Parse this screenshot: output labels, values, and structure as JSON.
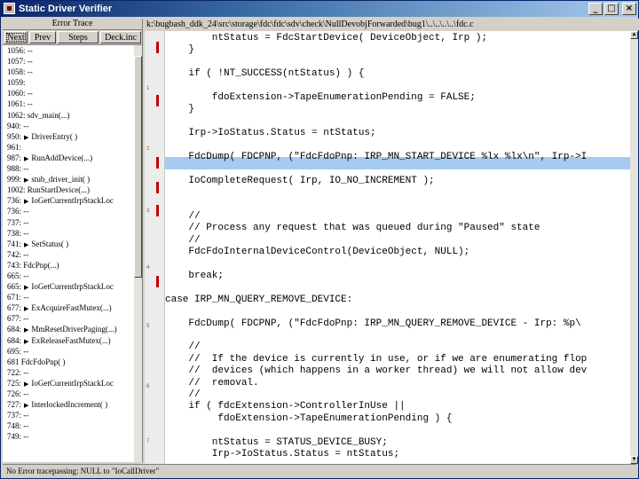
{
  "window": {
    "title": "Static Driver Verifier",
    "controls": {
      "minimize": "_",
      "maximize": "□",
      "close": "×"
    }
  },
  "trace_pane": {
    "title": "Error Trace",
    "buttons": [
      "Next",
      "Prev",
      "Steps",
      "Deck.inc"
    ],
    "rows": [
      {
        "text": "1056: --",
        "arrow": false
      },
      {
        "text": "1057: --",
        "arrow": false
      },
      {
        "text": "1058: --",
        "arrow": false
      },
      {
        "text": "1059:",
        "arrow": false
      },
      {
        "text": "1060: --",
        "arrow": false
      },
      {
        "text": "1061: --",
        "arrow": false
      },
      {
        "text": "1062: sdv_main(...)",
        "arrow": false
      },
      {
        "text": "940: --",
        "arrow": false
      },
      {
        "text": "950:",
        "arrow": true,
        "label": "DriverEntry( )"
      },
      {
        "text": "961:",
        "arrow": false
      },
      {
        "text": "987:",
        "arrow": true,
        "label": "RunAddDevice(...)"
      },
      {
        "text": "988: --",
        "arrow": false
      },
      {
        "text": "999:",
        "arrow": true,
        "label": "stub_driver_init( )"
      },
      {
        "text": "1002: RunStartDevice(...)",
        "arrow": false
      },
      {
        "text": "736:",
        "arrow": true,
        "label": "IoGetCurrentIrpStackLoc"
      },
      {
        "text": "736: --",
        "arrow": false
      },
      {
        "text": "737: --",
        "arrow": false
      },
      {
        "text": "738: --",
        "arrow": false
      },
      {
        "text": "741:",
        "arrow": true,
        "label": "SetStatus( )"
      },
      {
        "text": "742: --",
        "arrow": false
      },
      {
        "text": "743: FdcPnp(...)",
        "arrow": false
      },
      {
        "text": "665: --",
        "arrow": false
      },
      {
        "text": "665:",
        "arrow": true,
        "label": "IoGetCurrentIrpStackLoc"
      },
      {
        "text": "671: --",
        "arrow": false
      },
      {
        "text": "677:",
        "arrow": true,
        "label": "ExAcquireFastMutex(...)"
      },
      {
        "text": "677: --",
        "arrow": false
      },
      {
        "text": "684:",
        "arrow": true,
        "label": "MmResetDriverPaging(...)"
      },
      {
        "text": "684:",
        "arrow": true,
        "label": "ExReleaseFastMutex(...)"
      },
      {
        "text": "695: --",
        "arrow": false
      },
      {
        "text": "681 FdcFdoPnp( )",
        "arrow": false
      },
      {
        "text": "722: --",
        "arrow": false
      },
      {
        "text": "725:",
        "arrow": true,
        "label": "IoGetCurrentIrpStackLoc"
      },
      {
        "text": "726: --",
        "arrow": false
      },
      {
        "text": "727:",
        "arrow": true,
        "label": "InterlockedIncrement( )"
      },
      {
        "text": "737: --",
        "arrow": false
      },
      {
        "text": "748: --",
        "arrow": false
      },
      {
        "text": "749: --",
        "arrow": false
      }
    ]
  },
  "editor": {
    "file_path": "k:\\bugbash_ddk_24\\src\\storage\\fdc\\fdc\\sdv\\check\\NullDevobjForwarded\\bug1\\..\\..\\..\\..\\fdc.c",
    "gutter_labels": [
      "1",
      "2",
      "3",
      "4",
      "5",
      "6",
      "7",
      "8",
      "9"
    ],
    "lines": [
      "        ntStatus = FdcStartDevice( DeviceObject, Irp );",
      "    }",
      "",
      "    if ( !NT_SUCCESS(ntStatus) ) {",
      "",
      "        fdoExtension->TapeEnumerationPending = FALSE;",
      "    }",
      "",
      "    Irp->IoStatus.Status = ntStatus;",
      "",
      "    FdcDump( FDCPNP, (\"FdcFdoPnp: IRP_MN_START_DEVICE %lx %lx\\n\", Irp->I",
      "",
      "    IoCompleteRequest( Irp, IO_NO_INCREMENT );",
      "",
      "",
      "    //",
      "    // Process any request that was queued during \"Paused\" state",
      "    //",
      "    FdcFdoInternalDeviceControl(DeviceObject, NULL);",
      "",
      "    break;",
      "",
      "case IRP_MN_QUERY_REMOVE_DEVICE:",
      "",
      "    FdcDump( FDCPNP, (\"FdcFdoPnp: IRP_MN_QUERY_REMOVE_DEVICE - Irp: %p\\",
      "",
      "    //",
      "    //  If the device is currently in use, or if we are enumerating flop",
      "    //  devices (which happens in a worker thread) we will not allow dev",
      "    //  removal.",
      "    //",
      "    if ( fdcExtension->ControllerInUse ||",
      "         fdoExtension->TapeEnumerationPending ) {",
      "",
      "        ntStatus = STATUS_DEVICE_BUSY;",
      "        Irp->IoStatus.Status = ntStatus;"
    ]
  },
  "status_bar": {
    "text": "No Error tracepassing: NULL to \"IoCallDriver\""
  }
}
